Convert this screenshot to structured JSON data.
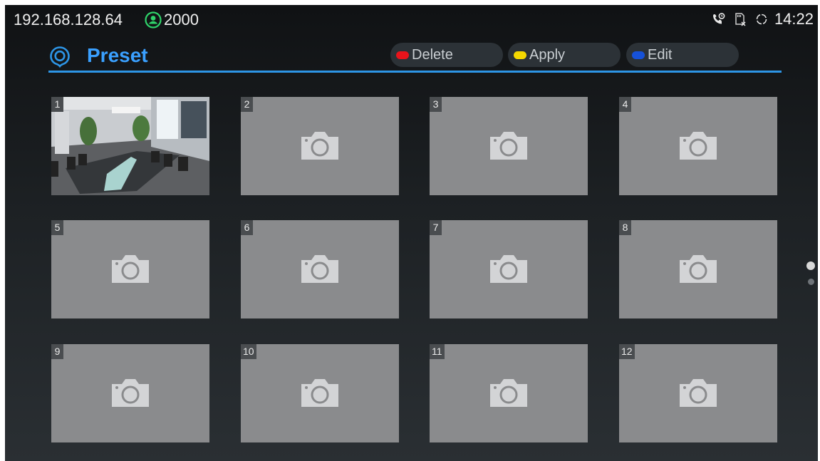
{
  "status_bar": {
    "ip": "192.168.128.64",
    "account": "2000",
    "time": "14:22",
    "icons": [
      "account-registered-icon",
      "call-forward-icon",
      "sd-card-removed-icon",
      "sync-icon"
    ]
  },
  "header": {
    "title": "Preset",
    "buttons": [
      {
        "label": "Delete",
        "color": "#e8141b"
      },
      {
        "label": "Apply",
        "color": "#f5d800"
      },
      {
        "label": "Edit",
        "color": "#1651d8"
      }
    ]
  },
  "presets": [
    {
      "number": "1",
      "has_image": true
    },
    {
      "number": "2",
      "has_image": false
    },
    {
      "number": "3",
      "has_image": false
    },
    {
      "number": "4",
      "has_image": false
    },
    {
      "number": "5",
      "has_image": false
    },
    {
      "number": "6",
      "has_image": false
    },
    {
      "number": "7",
      "has_image": false
    },
    {
      "number": "8",
      "has_image": false
    },
    {
      "number": "9",
      "has_image": false
    },
    {
      "number": "10",
      "has_image": false
    },
    {
      "number": "11",
      "has_image": false
    },
    {
      "number": "12",
      "has_image": false
    }
  ],
  "pagination": {
    "pages": 2,
    "current": 1
  },
  "colors": {
    "accent": "#2d95e6",
    "title": "#3aa0ff",
    "account_green": "#2fd36a"
  }
}
